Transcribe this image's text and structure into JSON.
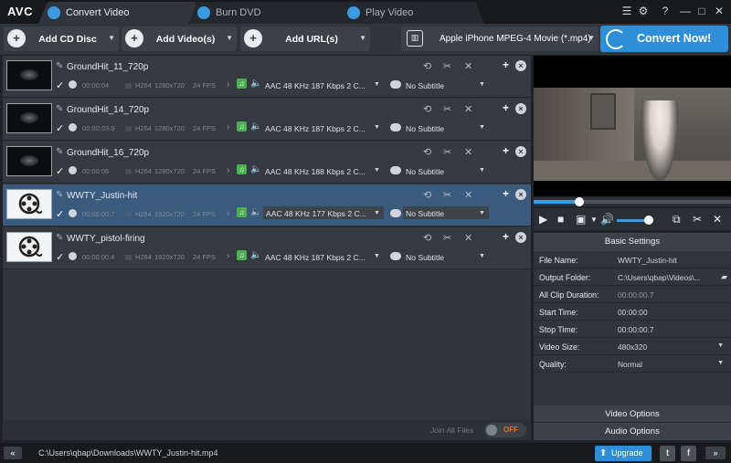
{
  "app": {
    "logo": "AVC"
  },
  "tabs": [
    {
      "label": "Convert Video"
    },
    {
      "label": "Burn DVD"
    },
    {
      "label": "Play Video"
    }
  ],
  "window_controls": {
    "menu": "☰",
    "settings": "⚙",
    "help": "?",
    "minimize": "—",
    "maximize": "□",
    "close": "✕"
  },
  "toolbar": {
    "add_cd": "Add CD Disc",
    "add_video": "Add Video(s)",
    "add_url": "Add URL(s)",
    "profile": "Apple iPhone MPEG-4 Movie (*.mp4)",
    "convert": "Convert Now!"
  },
  "files": [
    {
      "name": "GroundHit_11_720p",
      "duration": "00:00:04",
      "codec": "H264",
      "resolution": "1280x720",
      "fps": "24 FPS",
      "audio": "AAC 48 KHz 187 Kbps 2 C...",
      "subtitle": "No Subtitle",
      "selected": false,
      "thumb": "dark"
    },
    {
      "name": "GroundHit_14_720p",
      "duration": "00:00:03.9",
      "codec": "H264",
      "resolution": "1280x720",
      "fps": "24 FPS",
      "audio": "AAC 48 KHz 187 Kbps 2 C...",
      "subtitle": "No Subtitle",
      "selected": false,
      "thumb": "dark"
    },
    {
      "name": "GroundHit_16_720p",
      "duration": "00:00:06",
      "codec": "H264",
      "resolution": "1280x720",
      "fps": "24 FPS",
      "audio": "AAC 48 KHz 188 Kbps 2 C...",
      "subtitle": "No Subtitle",
      "selected": false,
      "thumb": "dark"
    },
    {
      "name": "WWTY_Justin-hit",
      "duration": "00:00:00.7",
      "codec": "H264",
      "resolution": "1920x720",
      "fps": "24 FPS",
      "audio": "AAC 48 KHz 177 Kbps 2 C...",
      "subtitle": "No Subtitle",
      "selected": true,
      "thumb": "reel"
    },
    {
      "name": "WWTY_pistol-firing",
      "duration": "00:00:00.4",
      "codec": "H264",
      "resolution": "1920x720",
      "fps": "24 FPS",
      "audio": "AAC 48 KHz 187 Kbps 2 C...",
      "subtitle": "No Subtitle",
      "selected": false,
      "thumb": "reel"
    }
  ],
  "join": {
    "label": "Join All Files",
    "state": "OFF"
  },
  "player": {
    "progress": 0.23,
    "volume": 0.62
  },
  "settings": {
    "header": "Basic Settings",
    "rows": [
      {
        "key": "File Name:",
        "value": "WWTY_Justin-hit",
        "muted": false,
        "control": ""
      },
      {
        "key": "Output Folder:",
        "value": "C:\\Users\\qbap\\Videos\\...",
        "muted": false,
        "control": "folder"
      },
      {
        "key": "All Clip Duration:",
        "value": "00:00:00.7",
        "muted": true,
        "control": ""
      },
      {
        "key": "Start Time:",
        "value": "00:00:00",
        "muted": false,
        "control": ""
      },
      {
        "key": "Stop Time:",
        "value": "00:00:00.7",
        "muted": false,
        "control": ""
      },
      {
        "key": "Video Size:",
        "value": "480x320",
        "muted": false,
        "control": "dropdown"
      },
      {
        "key": "Quality:",
        "value": "Normal",
        "muted": false,
        "control": "dropdown"
      }
    ],
    "video_options": "Video Options",
    "audio_options": "Audio Options"
  },
  "status": {
    "collapse": "«",
    "path": "C:\\Users\\qbap\\Downloads\\WWTY_Justin-hit.mp4",
    "upgrade": "Upgrade",
    "expand": "»"
  },
  "colors": {
    "accent": "#2e8fd8",
    "selected_row": "#3a5a7e",
    "toggle_off": "#e2732a"
  }
}
